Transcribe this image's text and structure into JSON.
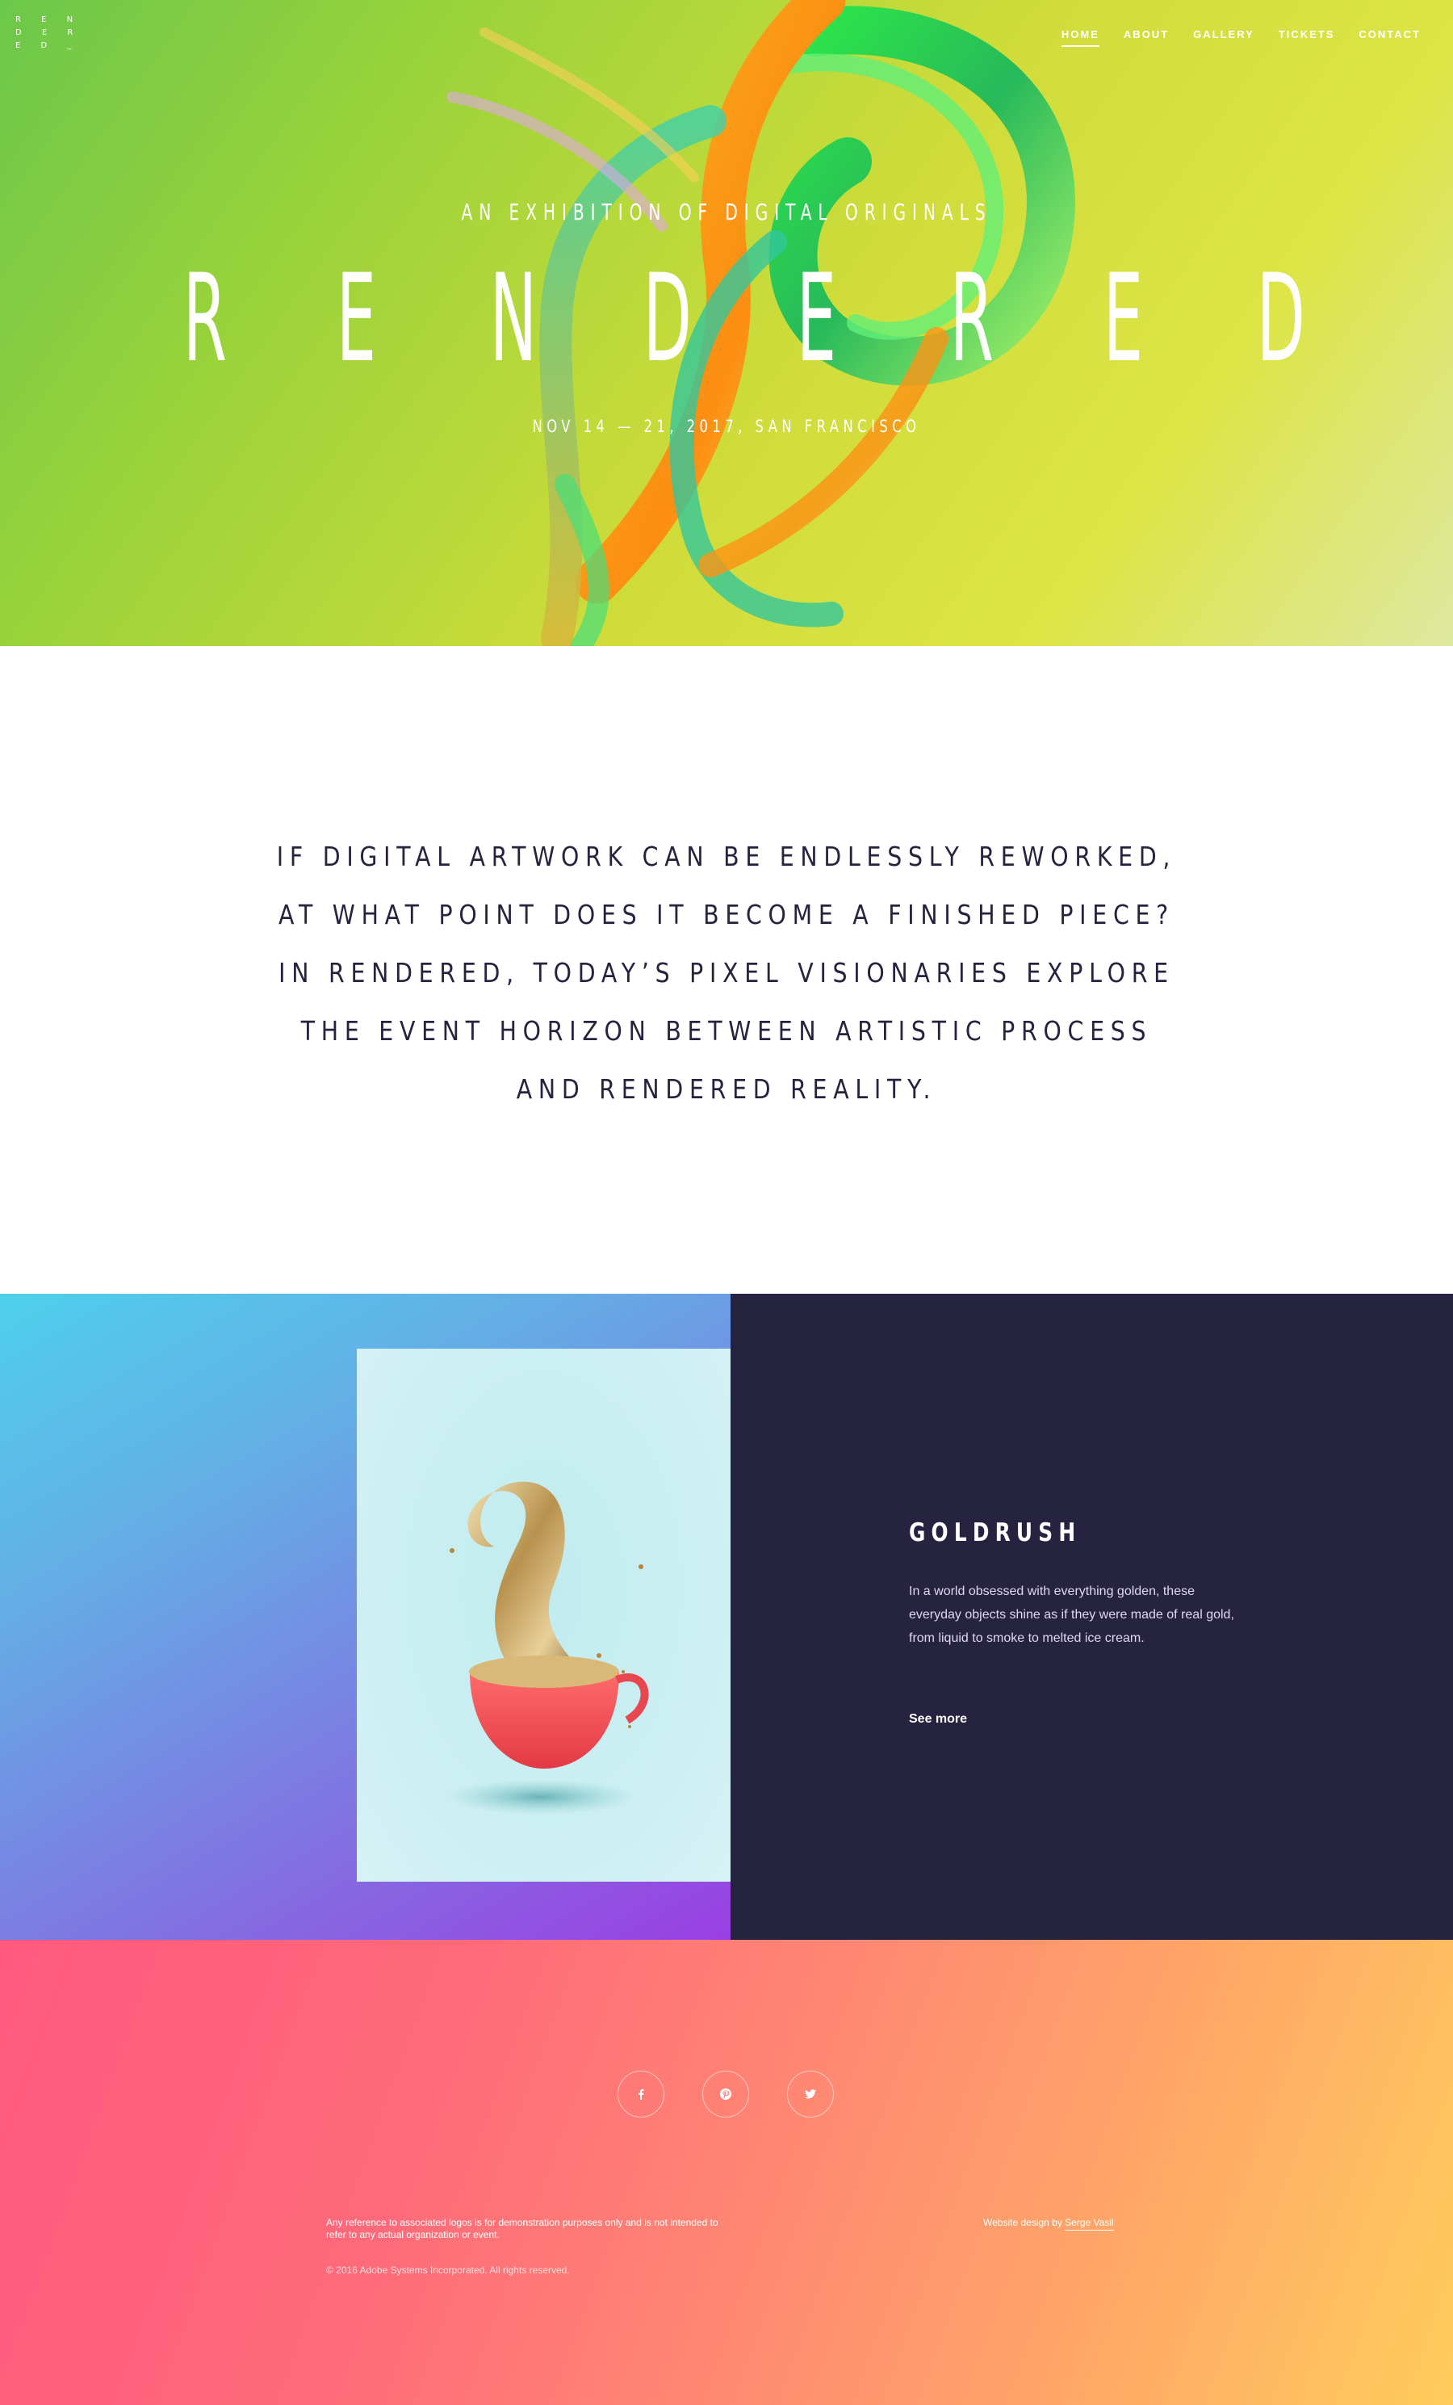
{
  "logo": {
    "text": "R E N\nD E R\nE D _"
  },
  "nav": {
    "items": [
      {
        "label": "HOME",
        "active": true
      },
      {
        "label": "ABOUT",
        "active": false
      },
      {
        "label": "GALLERY",
        "active": false
      },
      {
        "label": "TICKETS",
        "active": false
      },
      {
        "label": "CONTACT",
        "active": false
      }
    ]
  },
  "hero": {
    "subtitle": "AN EXHIBITION OF DIGITAL ORIGINALS",
    "title_letters": [
      "R",
      "E",
      "N",
      "D",
      "E",
      "R",
      "E",
      "D"
    ],
    "date": "NOV 14 — 21, 2017, SAN FRANCISCO"
  },
  "statement": {
    "text": "IF DIGITAL ARTWORK CAN BE ENDLESSLY REWORKED, AT WHAT POINT DOES IT BECOME A FINISHED PIECE? IN RENDERED, TODAY’S PIXEL VISIONARIES EXPLORE THE EVENT HORIZON BETWEEN ARTISTIC PROCESS AND RENDERED REALITY."
  },
  "feature": {
    "title": "GOLDRUSH",
    "description": "In a world obsessed with everything golden, these everyday objects shine as if they were made of real gold, from liquid to smoke to melted ice cream.",
    "link_label": "See more"
  },
  "footer": {
    "social": [
      {
        "icon": "facebook-icon"
      },
      {
        "icon": "pinterest-icon"
      },
      {
        "icon": "twitter-icon"
      }
    ],
    "disclaimer": "Any reference to associated logos is for demonstration purposes only and is not intended to refer to any actual organization or event.",
    "copyright": "© 2016 Adobe Systems Incorporated. All rights reserved.",
    "credit_prefix": "Website design by ",
    "credit_name": "Serge Vasil"
  },
  "colors": {
    "hero_green": "#6cc74a",
    "hero_yellow": "#dde546",
    "ink": "#26233f",
    "feature_dark": "#262340",
    "feature_gradient_start": "#4fd0ec",
    "feature_gradient_end": "#9a3fe2",
    "footer_pink": "#ff5a7e",
    "footer_yellow": "#ffcd5c"
  }
}
